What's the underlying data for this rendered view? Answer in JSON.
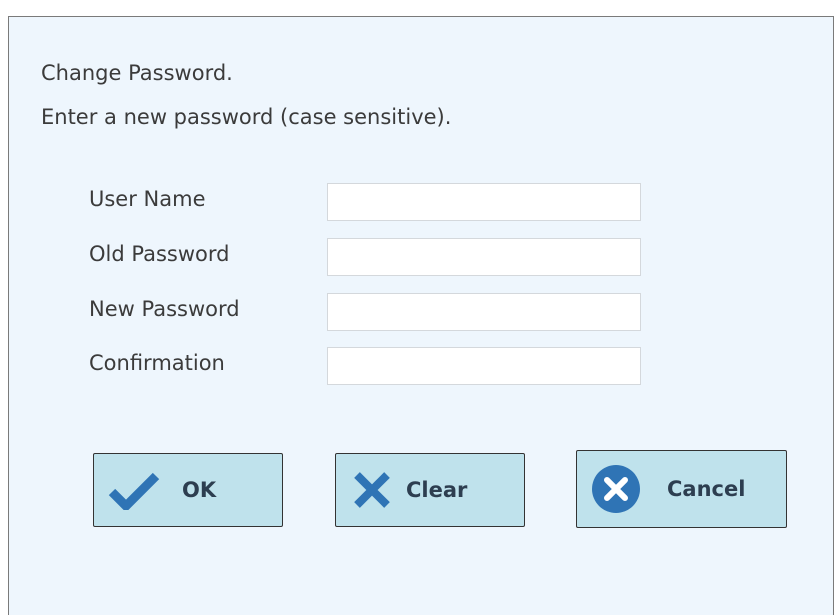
{
  "dialog": {
    "message_line1": "Change Password.",
    "message_line2": "Enter a new password (case sensitive)."
  },
  "fields": [
    {
      "label": "User Name",
      "value": ""
    },
    {
      "label": "Old Password",
      "value": ""
    },
    {
      "label": "New Password",
      "value": ""
    },
    {
      "label": "Confirmation",
      "value": ""
    }
  ],
  "buttons": {
    "ok": {
      "label": "OK",
      "icon": "check-icon"
    },
    "clear": {
      "label": "Clear",
      "icon": "x-icon"
    },
    "cancel": {
      "label": "Cancel",
      "icon": "cancel-circle-icon"
    }
  },
  "colors": {
    "dialog_background": "#eef6fd",
    "button_background": "#bfe2ec",
    "icon_color": "#2f74b5"
  }
}
